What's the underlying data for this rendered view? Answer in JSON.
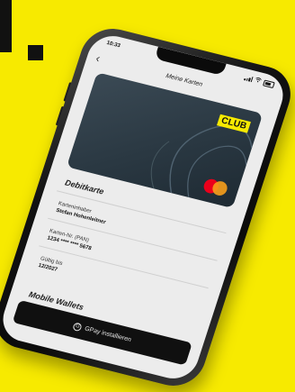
{
  "status_bar": {
    "time": "10:33"
  },
  "nav": {
    "title": "Meine Karten",
    "back_icon": "chevron-left-icon"
  },
  "card": {
    "brand": "CLUB",
    "network_icon": "mastercard-icon"
  },
  "debit_section": {
    "title": "Debitkarte",
    "holder_label": "Karteninhaber",
    "holder_value": "Stefan Hohenleitner",
    "number_label": "Karten-Nr. (PAN)",
    "number_value": "1234 **** **** 5678",
    "valid_label": "Gültig bis",
    "valid_value": "12/2027"
  },
  "wallet_section": {
    "title": "Mobile Wallets",
    "button_label": "GPay installieren"
  },
  "colors": {
    "background": "#f7ea00",
    "club_yellow": "#f7ea00",
    "card": "#2f3d47"
  }
}
